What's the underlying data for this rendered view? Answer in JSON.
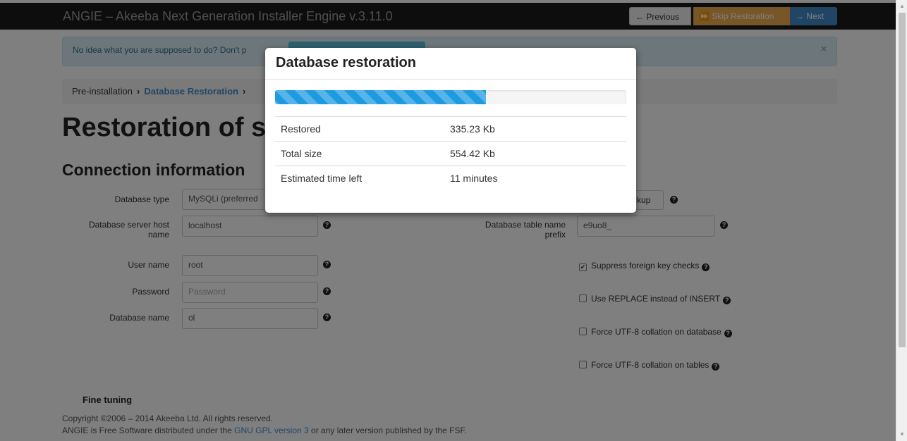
{
  "navbar": {
    "title": "ANGIE – Akeeba Next Generation Installer Engine v.3.11.0",
    "prev_label": "← Previous",
    "skip_label": "⏩ Skip Restoration",
    "next_label": "→ Next"
  },
  "alert": {
    "text": "No idea what you are supposed to do? Don't p",
    "close": "×"
  },
  "breadcrumb": {
    "step1": "Pre-installation",
    "step2": "Database Restoration"
  },
  "page": {
    "title": "Restoration of si",
    "section": "Connection information",
    "fine_tuning": "Fine tuning"
  },
  "form": {
    "db_type_label": "Database type",
    "db_type_value": "MySQLi (preferred",
    "host_label_1": "Database server host",
    "host_label_2": "name",
    "host_value": "localhost",
    "user_label": "User name",
    "user_value": "root",
    "password_label": "Password",
    "password_placeholder": "Password",
    "dbname_label": "Database name",
    "dbname_value": "ol",
    "prefix_label_1": "Database table name",
    "prefix_label_2": "prefix",
    "prefix_value": "e9uo8_",
    "backup_label": "ckup",
    "suppress_fk": "Suppress foreign key checks",
    "use_replace": "Use REPLACE instead of INSERT",
    "force_utf8_db": "Force UTF-8 collation on database",
    "force_utf8_tables": "Force UTF-8 collation on tables"
  },
  "footer": {
    "line1": "Copyright ©2006 – 2014 Akeeba Ltd. All rights reserved.",
    "line2_pre": "ANGIE is Free Software distributed under the ",
    "line2_link": "GNU GPL version 3",
    "line2_post": " or any later version published by the FSF."
  },
  "modal": {
    "title": "Database restoration",
    "progress_fraction": 0.6,
    "rows": [
      {
        "label": "Restored",
        "value": "335.23 Kb"
      },
      {
        "label": "Total size",
        "value": "554.42 Kb"
      },
      {
        "label": "Estimated time left",
        "value": "11 minutes"
      }
    ]
  },
  "colors": {
    "navbar": "#1b1b1b",
    "skip_button": "#f0ad4e",
    "next_button": "#428bca",
    "progress": "#1e9be0"
  }
}
